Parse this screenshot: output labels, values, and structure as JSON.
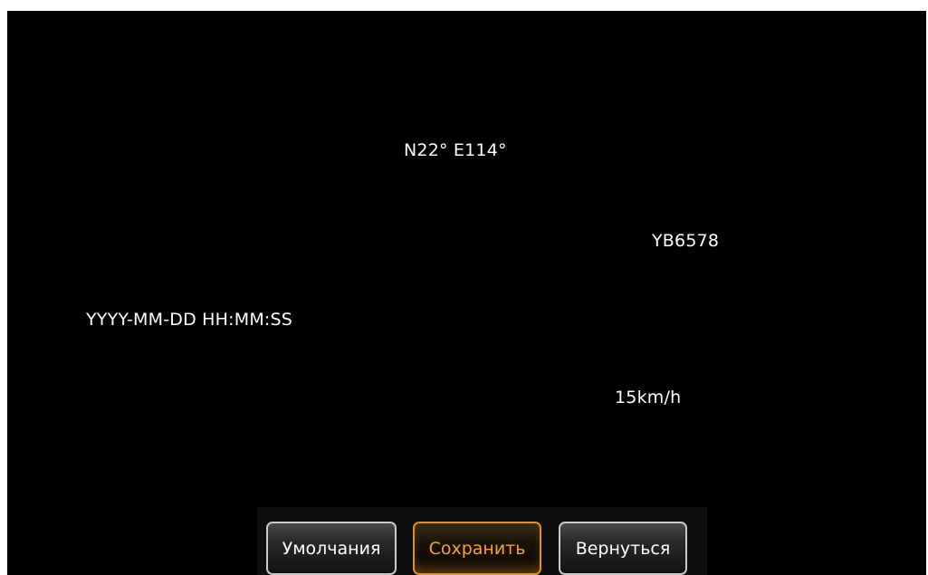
{
  "overlay": {
    "gps": "N22° E114°",
    "plate": "YB6578",
    "datetime": "YYYY-MM-DD HH:MM:SS",
    "speed": "15km/h"
  },
  "buttons": {
    "defaults_label": "Умолчания",
    "save_label": "Сохранить",
    "back_label": "Вернуться"
  },
  "colors": {
    "background": "#000000",
    "text": "#ffffff",
    "accent": "#f2a33a"
  }
}
